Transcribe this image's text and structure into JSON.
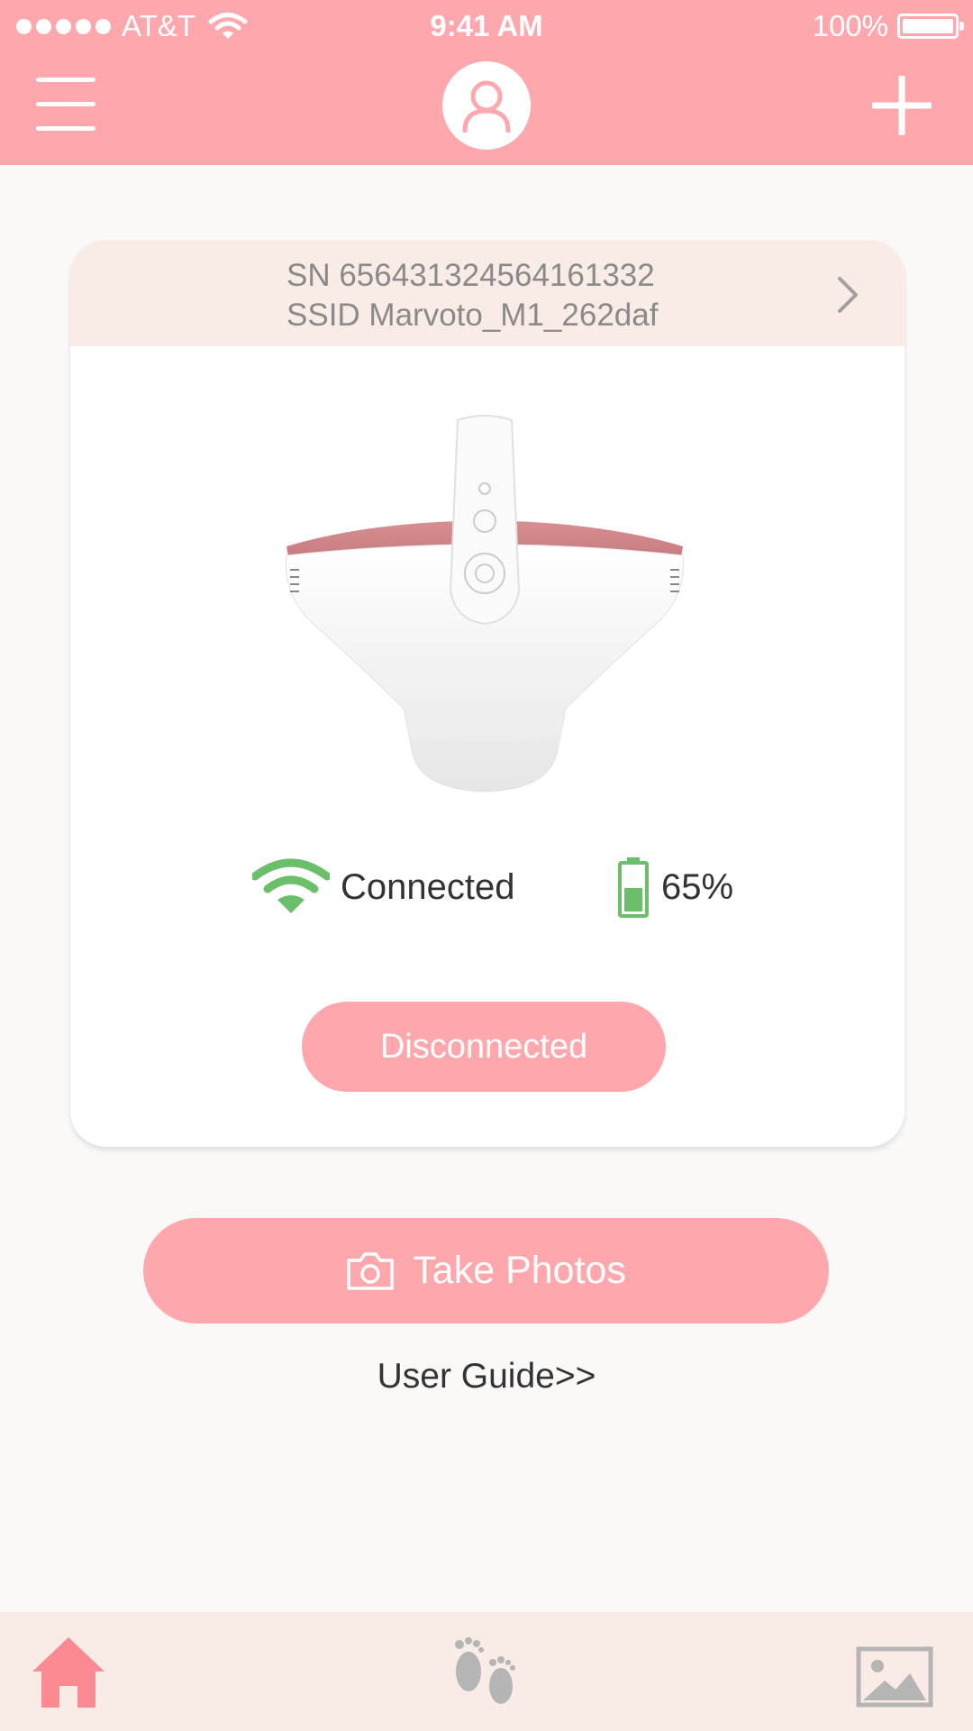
{
  "status_bar": {
    "carrier": "AT&T",
    "time": "9:41 AM",
    "battery": "100%"
  },
  "header": {
    "menu_icon": "hamburger-menu-icon",
    "profile_icon": "user-icon",
    "add_icon": "plus-icon"
  },
  "device": {
    "sn_line": "SN 656431324564161332",
    "ssid_line": "SSID Marvoto_M1_262daf",
    "connection_status": "Connected",
    "battery_level": "65%",
    "battery_fraction": 0.65,
    "disconnect_label": "Disconnected"
  },
  "actions": {
    "take_photos_label": "Take Photos",
    "user_guide_label": "User Guide>>"
  },
  "tabs": [
    {
      "name": "home",
      "icon": "home-icon",
      "active": true
    },
    {
      "name": "baby",
      "icon": "footprints-icon",
      "active": false
    },
    {
      "name": "gallery",
      "icon": "image-icon",
      "active": false
    }
  ],
  "colors": {
    "accent": "#fea8ae",
    "card_header": "#f9ece6",
    "success": "#6bbf6b",
    "inactive_icon": "#b5b5b5"
  }
}
